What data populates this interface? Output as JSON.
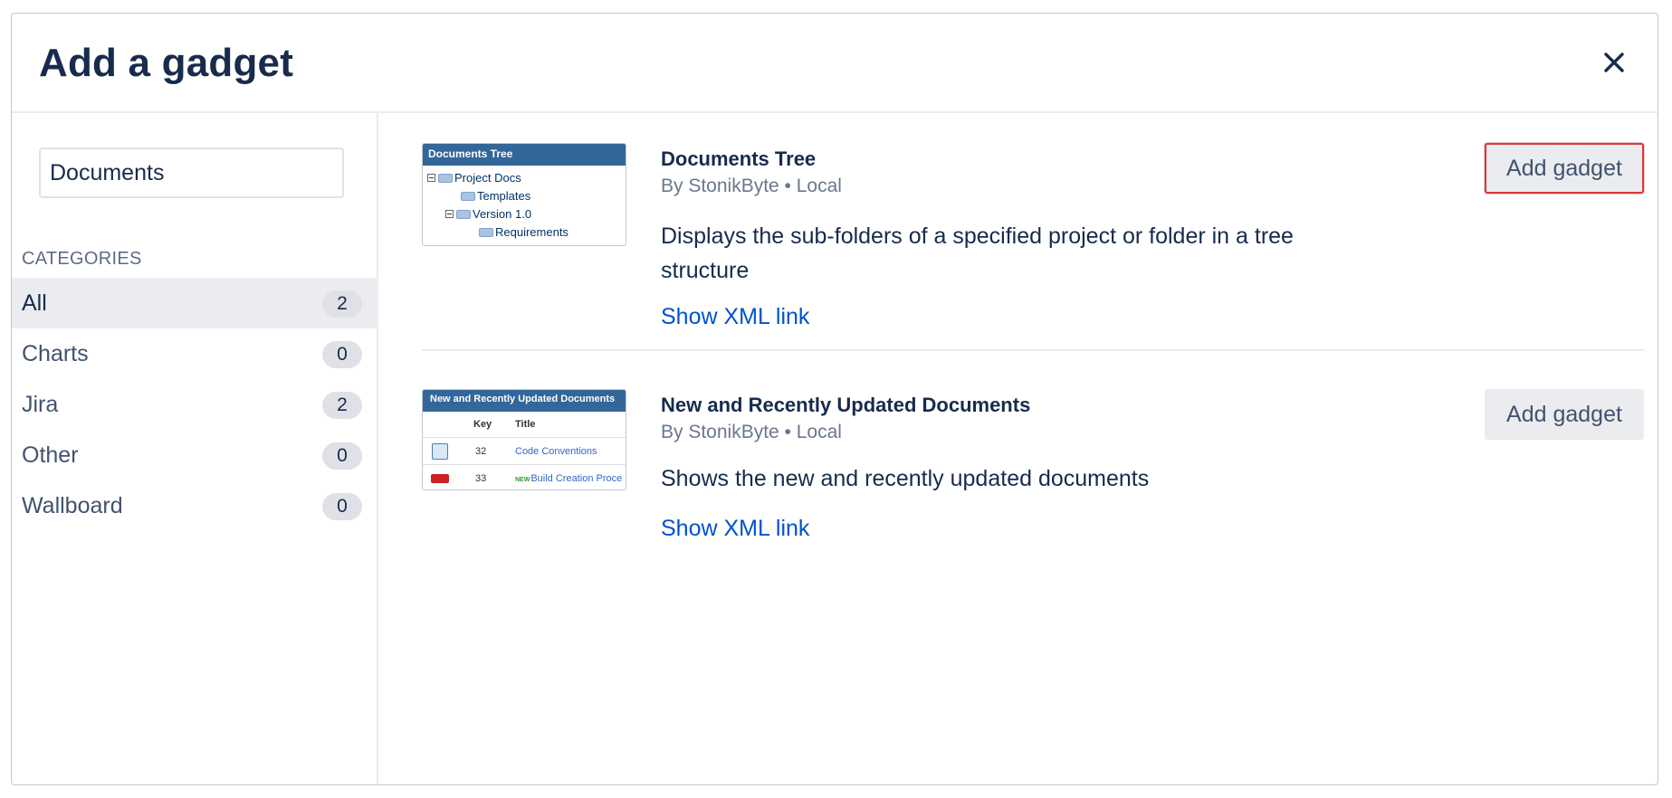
{
  "dialog": {
    "title": "Add a gadget",
    "close_icon": "close-icon"
  },
  "sidebar": {
    "search": {
      "value": "Documents",
      "placeholder": ""
    },
    "categories_heading": "CATEGORIES",
    "categories": [
      {
        "label": "All",
        "count": "2",
        "active": true
      },
      {
        "label": "Charts",
        "count": "0",
        "active": false
      },
      {
        "label": "Jira",
        "count": "2",
        "active": false
      },
      {
        "label": "Other",
        "count": "0",
        "active": false
      },
      {
        "label": "Wallboard",
        "count": "0",
        "active": false
      }
    ]
  },
  "gadgets": [
    {
      "title": "Documents Tree",
      "meta": "By StonikByte • Local",
      "description": "Displays the sub-folders of a specified project or folder in a tree structure",
      "link": "Show XML link",
      "button": "Add gadget",
      "thumbnail": {
        "header": "Documents Tree",
        "rows": [
          "Project Docs",
          "Templates",
          "Version 1.0",
          "Requirements"
        ]
      }
    },
    {
      "title": "New and Recently Updated Documents",
      "meta": "By StonikByte • Local",
      "description": "Shows the new and recently updated documents",
      "link": "Show XML link",
      "button": "Add gadget",
      "thumbnail": {
        "header": "New and Recently Updated Documents",
        "col_key": "Key",
        "col_title": "Title",
        "rows": [
          {
            "key": "32",
            "title": "Code Conventions"
          },
          {
            "key": "33",
            "title": "Build Creation Proce"
          }
        ],
        "new_label": "NEW"
      }
    }
  ],
  "colors": {
    "text": "#172b4d",
    "link": "#0052cc",
    "thumb_header": "#336699",
    "focus_border": "#d63a3a"
  }
}
